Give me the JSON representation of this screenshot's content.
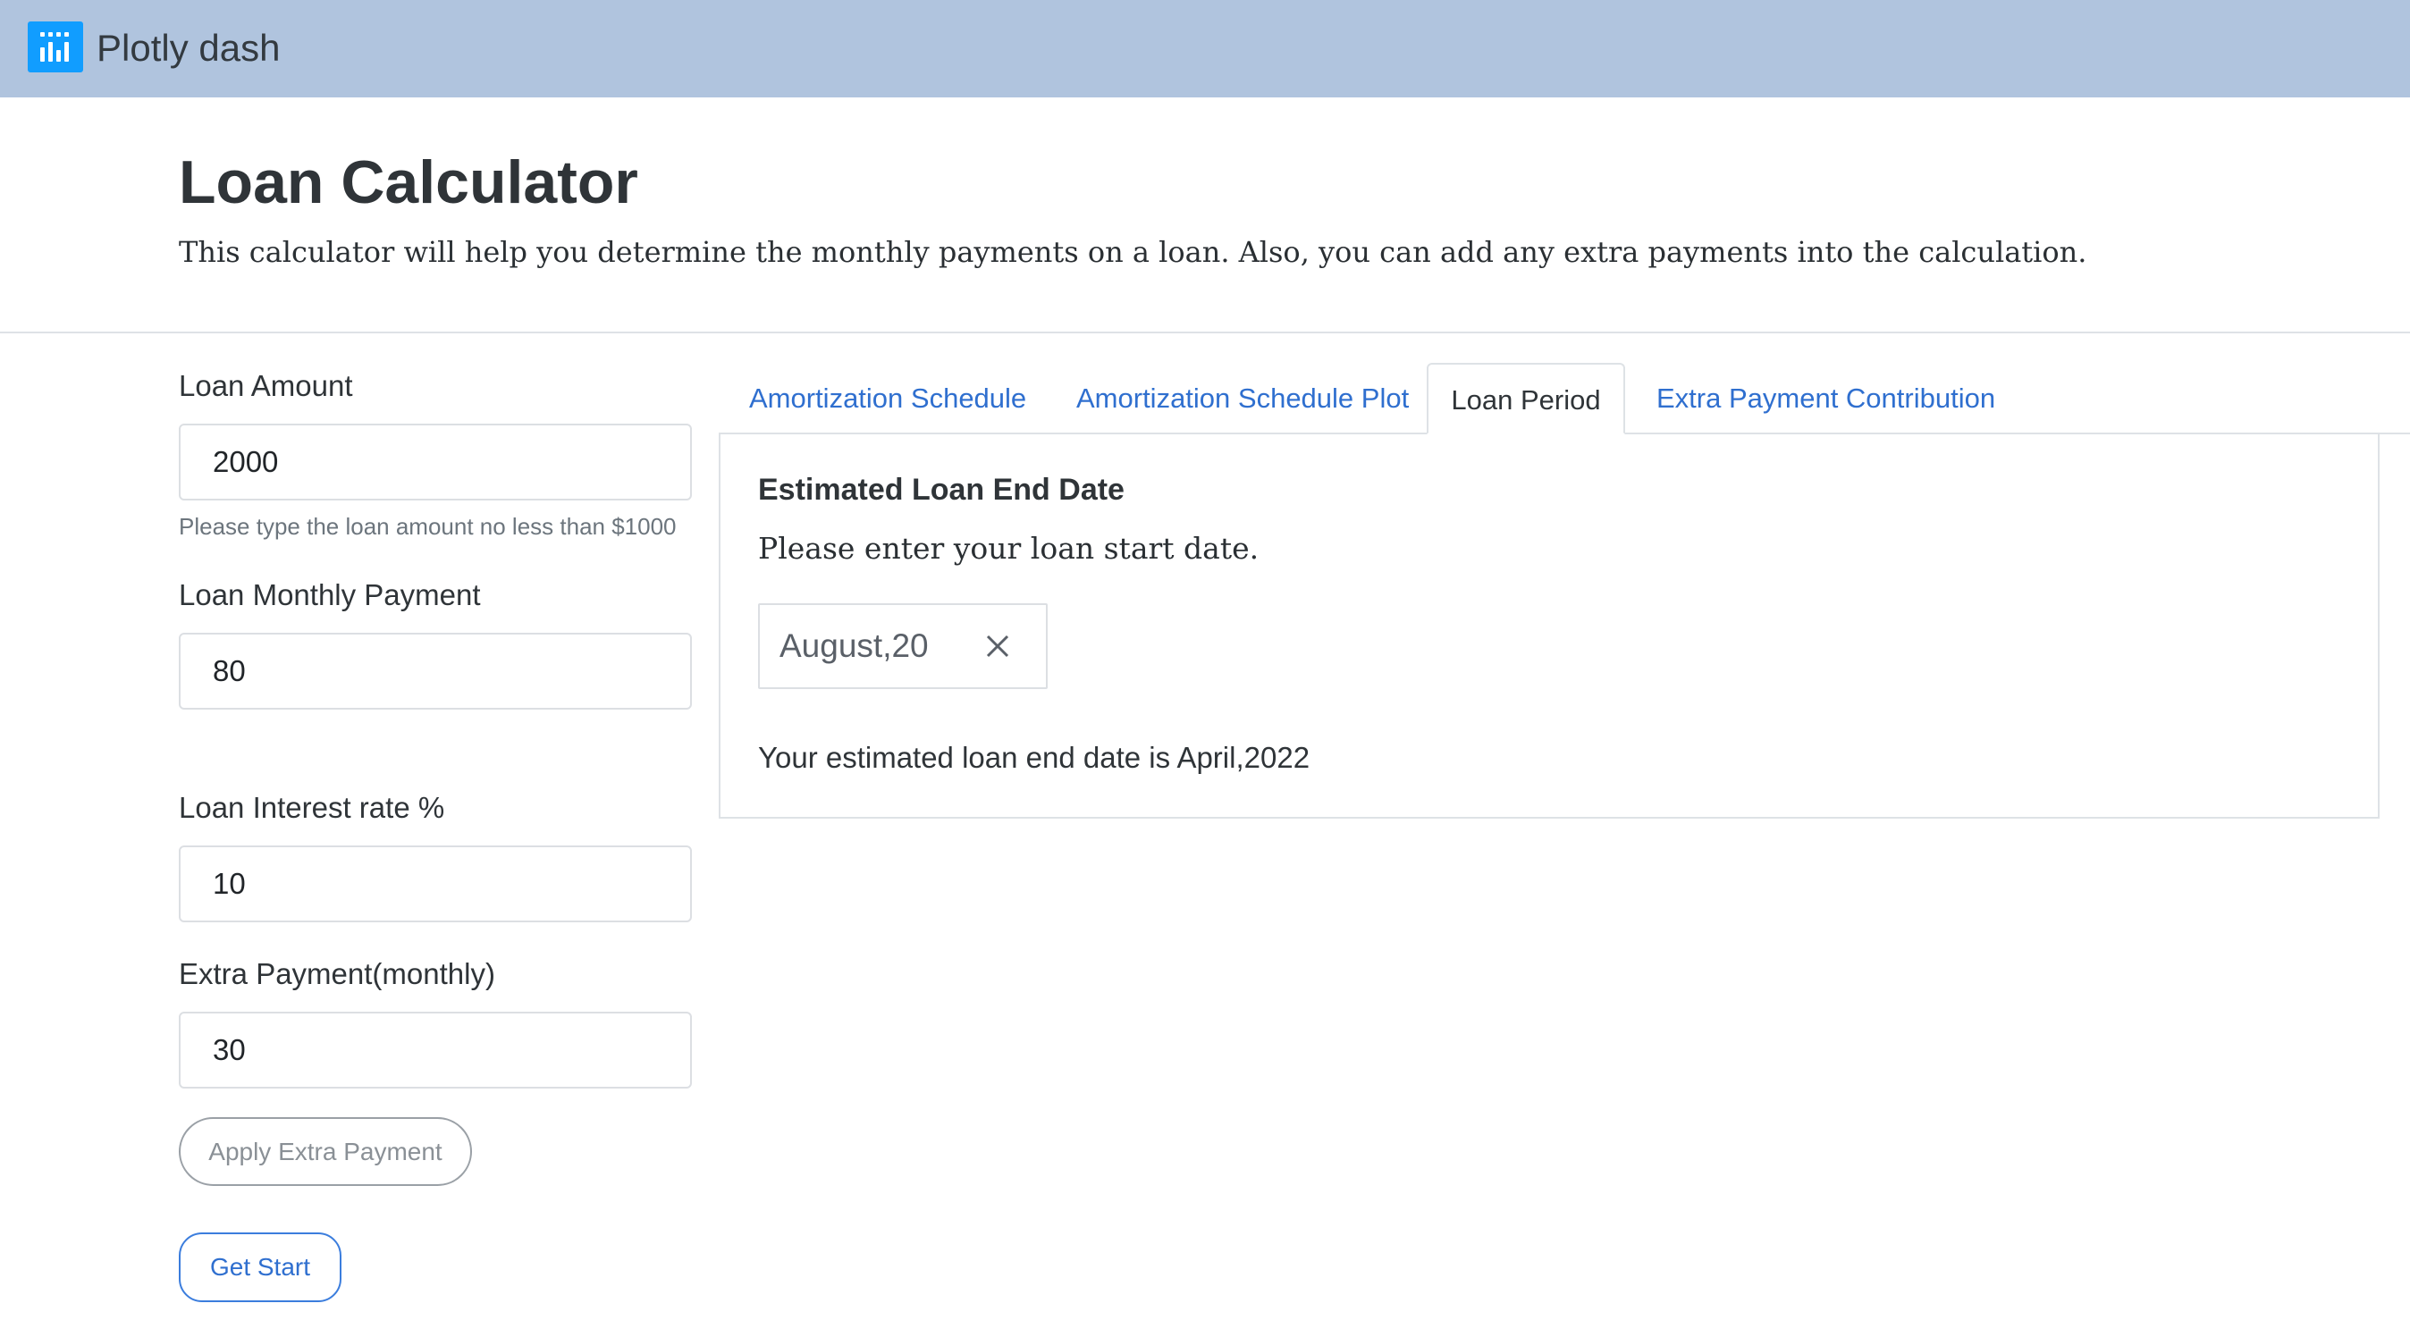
{
  "navbar": {
    "brand": "Plotly dash",
    "logo_icon": "plotly-dash-logo-icon",
    "background": "#b0c4de"
  },
  "header": {
    "title": "Loan Calculator",
    "subtitle": "This calculator will help you determine the monthly payments on a loan. Also, you can add any extra payments into the calculation."
  },
  "form": {
    "loan_amount": {
      "label": "Loan Amount",
      "value": "2000",
      "help": "Please type the loan amount no less than $1000"
    },
    "monthly_payment": {
      "label": "Loan Monthly Payment",
      "value": "80"
    },
    "interest_rate": {
      "label": "Loan Interest rate %",
      "value": "10"
    },
    "extra_payment": {
      "label": "Extra Payment(monthly)",
      "value": "30"
    },
    "apply_button": "Apply Extra Payment",
    "start_button": "Get Start"
  },
  "tabs": [
    {
      "label": "Amortization Schedule",
      "active": false
    },
    {
      "label": "Amortization Schedule Plot",
      "active": false
    },
    {
      "label": "Loan Period",
      "active": true
    },
    {
      "label": "Extra Payment Contribution",
      "active": false
    }
  ],
  "panel": {
    "title": "Estimated Loan End Date",
    "prompt": "Please enter your loan start date.",
    "date_value": "August,20",
    "clear_icon": "close-icon",
    "result": "Your estimated loan end date is April,2022"
  },
  "colors": {
    "link": "#2f6fcf",
    "logo": "#119dff"
  }
}
